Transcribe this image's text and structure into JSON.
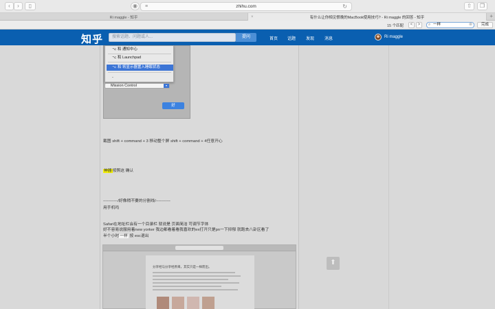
{
  "browser": {
    "url": "zhihu.com",
    "tabs": [
      {
        "title": "Ri maggle - 知乎"
      },
      {
        "title": "有什么让你相见恨晚的MacBook使用技巧? - Ri maggle 的回答 - 知乎",
        "active": true
      }
    ],
    "find": {
      "count_text": "15 个匹配",
      "prev": "<",
      "next": ">",
      "query": "一样",
      "done_label": "完成"
    }
  },
  "zhihu": {
    "logo": "知乎",
    "search_placeholder": "搜索话题、问题或人...",
    "ask_label": "提问",
    "nav": [
      "首页",
      "话题",
      "发现",
      "消息"
    ],
    "username": "Ri maggle"
  },
  "article": {
    "dropdown_items": [
      "⌥ 和 通知中心",
      "⌥ 和 Launchpad",
      "⌥ 和 将显示器置入睡眠状态",
      "-"
    ],
    "mission_control": "Mission Control",
    "ok_label": "好",
    "lines": [
      "截图 shift + command + 3",
      "神器",
      "按照这 确认",
      "-----------/好像稍不要的分割线/-----------",
      "用手机吗",
      "Safari在地址栏会有一个目录栏 就说是 页面简洁 可调节字体",
      "好不容易说服用着new yorker 我边都看着看我喜欢的ex打开只是pn一下抑郁 就跑去八卦区看了",
      "半个小时",
      "按 esc退出"
    ],
    "line1_rest": "移动整个屏 shift + command + 4任意开心",
    "line8_mid": "一样",
    "shot2_title": "分享经与分享经原来，其实只是一样而出。"
  },
  "icons": {
    "back": "back-arrow-icon",
    "forward": "forward-arrow-icon",
    "sidebar": "sidebar-icon",
    "reload": "reload-icon",
    "share": "share-icon",
    "tabs": "tabs-icon",
    "scroll_top": "arrow-up-icon"
  },
  "colors": {
    "zhihu_blue": "#0a5fb0",
    "highlight": "#f5f10a",
    "selection": "#3c75d6"
  }
}
